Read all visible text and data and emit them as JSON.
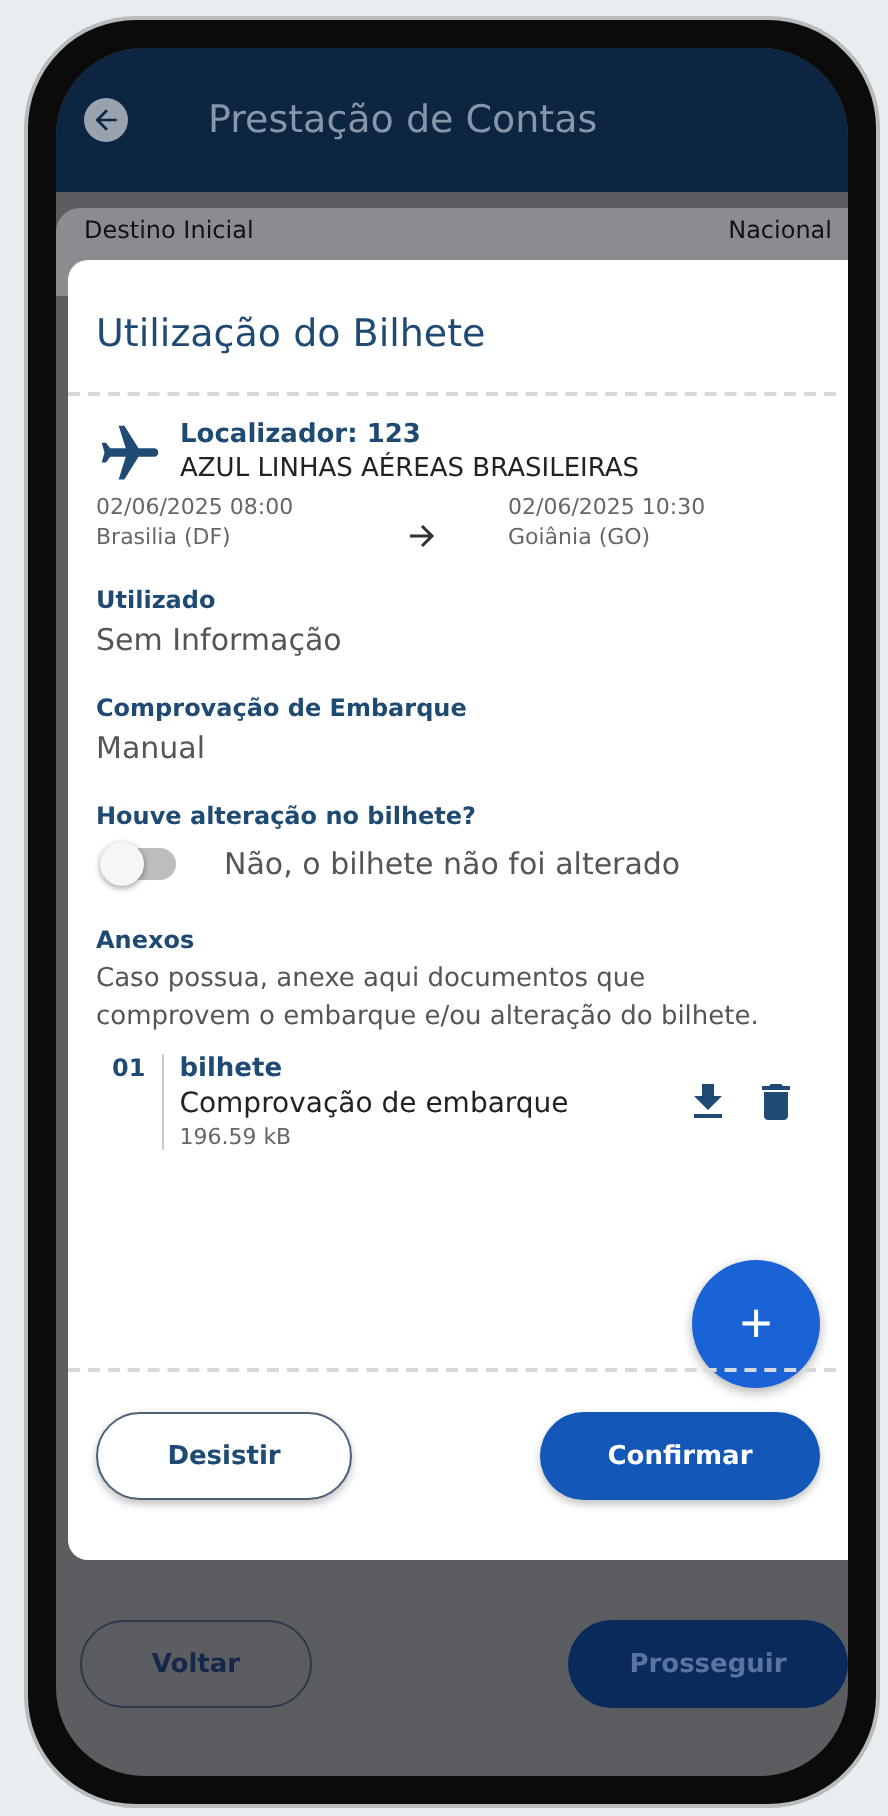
{
  "header": {
    "title": "Prestação de Contas"
  },
  "background": {
    "label": "Destino Inicial",
    "value": "Nacional",
    "buttons": [
      {
        "label": "Voltar",
        "kind": "outline",
        "disabled": false
      },
      {
        "label": "Prosseguir",
        "kind": "filled",
        "disabled": true
      }
    ]
  },
  "modal": {
    "title": "Utilização do Bilhete",
    "ticket": {
      "locator": "Localizador: 123",
      "airline": "AZUL LINHAS AÉREAS BRASILEIRAS",
      "departure": {
        "datetime": "02/06/2025  08:00",
        "city": "Brasilia (DF)"
      },
      "arrival": {
        "datetime": "02/06/2025  10:30",
        "city": "Goiânia (GO)"
      }
    },
    "fields": [
      {
        "label": "Utilizado",
        "value": "Sem Informação"
      },
      {
        "label": "Comprovação de Embarque",
        "value": "Manual"
      }
    ],
    "change": {
      "label": "Houve alteração no bilhete?",
      "on": false,
      "text": "Não, o bilhete não foi alterado"
    },
    "attachments": {
      "label": "Anexos",
      "hint": "Caso possua, anexe aqui documentos que comprovem o embarque e/ou alteração do bilhete.",
      "items": [
        {
          "index": "01",
          "name": "bilhete",
          "description": "Comprovação de embarque",
          "size": "196.59 kB"
        }
      ],
      "add": "+"
    },
    "buttons": [
      {
        "label": "Desistir",
        "kind": "outline"
      },
      {
        "label": "Confirmar",
        "kind": "filled"
      }
    ]
  }
}
